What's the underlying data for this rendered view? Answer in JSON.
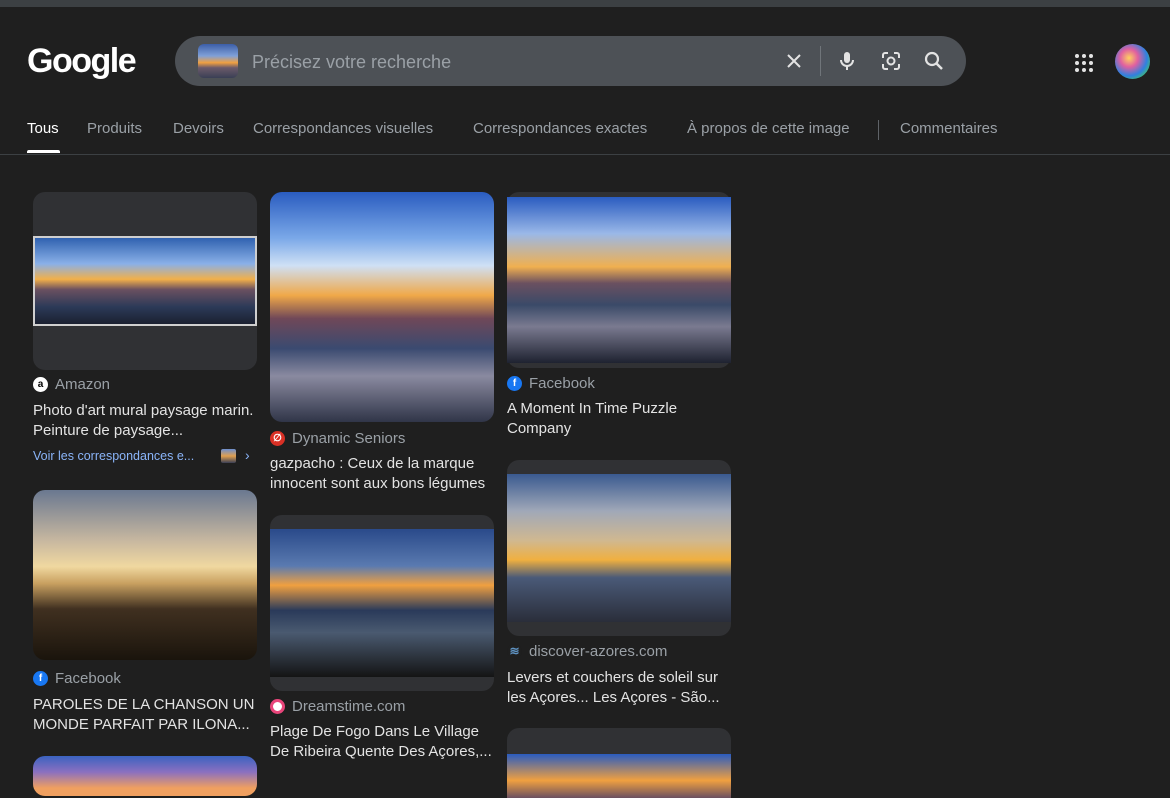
{
  "header": {
    "logo": "Google",
    "search": {
      "placeholder": "Précisez votre recherche",
      "icons": [
        "close-icon",
        "mic-icon",
        "lens-icon",
        "search-icon"
      ]
    },
    "apps_icon": "apps-grid-icon",
    "avatar_icon": "account-avatar"
  },
  "tabs": [
    {
      "label": "Tous",
      "active": true
    },
    {
      "label": "Produits"
    },
    {
      "label": "Devoirs"
    },
    {
      "label": "Correspondances visuelles"
    },
    {
      "label": "Correspondances exactes"
    },
    {
      "label": "À propos de cette image"
    },
    {
      "label": "Commentaires"
    }
  ],
  "results": [
    {
      "source": "Amazon",
      "title": "Photo d'art mural paysage marin. Peinture de paysage...",
      "see_more": "Voir les correspondances e..."
    },
    {
      "source": "Dynamic Seniors",
      "title": "gazpacho : Ceux de la marque innocent sont aux bons légumes"
    },
    {
      "source": "Facebook",
      "title": "A Moment In Time Puzzle Company"
    },
    {
      "source": "Facebook",
      "title": "PAROLES DE LA CHANSON UN MONDE PARFAIT PAR ILONA..."
    },
    {
      "source": "Dreamstime.com",
      "title": "Plage De Fogo Dans Le Village De Ribeira Quente Des Açores,..."
    },
    {
      "source": "discover-azores.com",
      "title": "Levers et couchers de soleil sur les Açores... Les Açores - São..."
    }
  ],
  "colors": {
    "background": "#1f1f1f",
    "searchbar": "#4d5156",
    "link": "#8ab4f8",
    "muted": "#9aa0a6"
  }
}
